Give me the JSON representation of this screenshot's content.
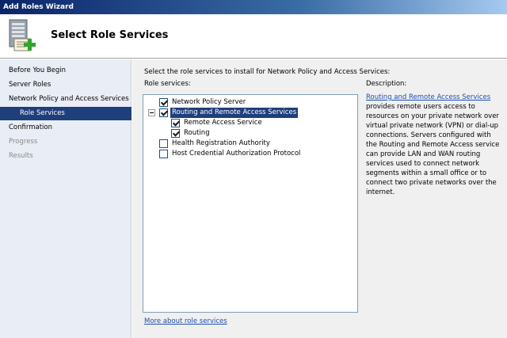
{
  "window": {
    "title": "Add Roles Wizard"
  },
  "header": {
    "title": "Select Role Services",
    "icon": "server-roles-icon"
  },
  "sidebar": {
    "items": [
      {
        "label": "Before You Begin",
        "state": "normal"
      },
      {
        "label": "Server Roles",
        "state": "normal"
      },
      {
        "label": "Network Policy and Access Services",
        "state": "normal"
      },
      {
        "label": "Role Services",
        "state": "active"
      },
      {
        "label": "Confirmation",
        "state": "normal"
      },
      {
        "label": "Progress",
        "state": "disabled"
      },
      {
        "label": "Results",
        "state": "disabled"
      }
    ]
  },
  "main": {
    "instruction": "Select the role services to install for Network Policy and Access Services:",
    "role_services_label": "Role services:",
    "role_services": [
      {
        "label": "Network Policy Server",
        "checked": true,
        "level": 0,
        "expander": false,
        "selected": false
      },
      {
        "label": "Routing and Remote Access Services",
        "checked": true,
        "level": 0,
        "expander": true,
        "selected": true
      },
      {
        "label": "Remote Access Service",
        "checked": true,
        "level": 1,
        "expander": false,
        "selected": false
      },
      {
        "label": "Routing",
        "checked": true,
        "level": 1,
        "expander": false,
        "selected": false
      },
      {
        "label": "Health Registration Authority",
        "checked": false,
        "level": 0,
        "expander": false,
        "selected": false
      },
      {
        "label": "Host Credential Authorization Protocol",
        "checked": false,
        "level": 0,
        "expander": false,
        "selected": false
      }
    ],
    "description_title": "Description:",
    "description_link": "Routing and Remote Access Services",
    "description_text": " provides remote users access to resources on your private network over virtual private network (VPN) or dial-up connections. Servers configured with the Routing and Remote Access service can provide LAN and WAN routing services used to connect network segments within a small office or to connect two private networks over the internet.",
    "more_link": "More about role services"
  },
  "colors": {
    "accent": "#1f3e7c",
    "link": "#1d4eb0",
    "sidebar_bg": "#e9edf5"
  }
}
